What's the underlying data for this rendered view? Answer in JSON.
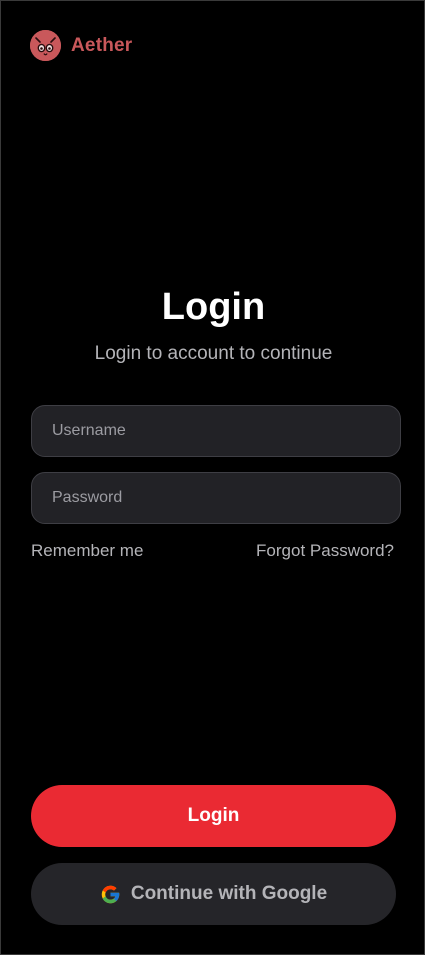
{
  "brand": {
    "name": "Aether",
    "logo_icon": "monster-face-icon",
    "color": "#c9585b"
  },
  "header": {
    "title": "Login",
    "subtitle": "Login to account to continue"
  },
  "form": {
    "username_placeholder": "Username",
    "password_placeholder": "Password",
    "remember_label": "Remember me",
    "forgot_label": "Forgot Password?"
  },
  "actions": {
    "login_label": "Login",
    "login_color": "#ea2a33",
    "google_label": "Continue with Google",
    "google_icon": "google-g-icon"
  }
}
